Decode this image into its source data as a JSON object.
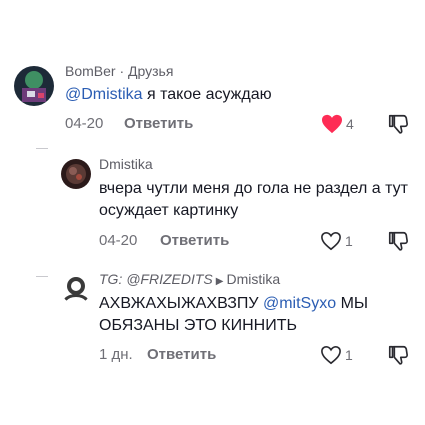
{
  "comments": [
    {
      "author": "BomBer",
      "tag": "· Друзья",
      "mention": "@Dmistika",
      "text": " я такое асуждаю",
      "time": "04-20",
      "reply_label": "Ответить",
      "likes": "4"
    },
    {
      "author": "Dmistika",
      "text": "вчера чутли меня до гола не раздел а тут осуждает картинку",
      "time": "04-20",
      "reply_label": "Ответить",
      "likes": "1"
    },
    {
      "author": "TG: @FRIZEDITS",
      "reply_to": "Dmistika",
      "text_before": "АХВЖАХЫЖАХВЗПУ ",
      "mention": "@mitSyxo",
      "text_after": " МЫ ОБЯЗАНЫ ЭТО КИННИТЬ",
      "time": "1 дн.",
      "reply_label": "Ответить",
      "likes": "1"
    }
  ],
  "colors": {
    "like_active": "#fe2c55",
    "mention": "#2b5db3"
  }
}
